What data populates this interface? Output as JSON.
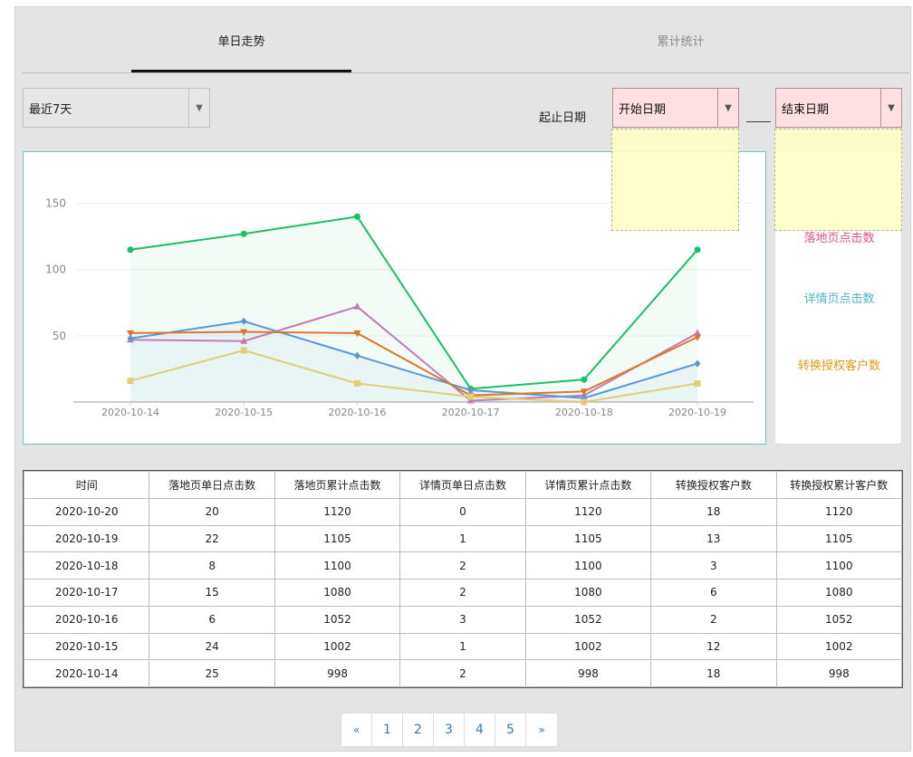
{
  "tabs": [
    {
      "label": "单日走势",
      "active": true
    },
    {
      "label": "累计统计",
      "active": false
    }
  ],
  "filters": {
    "range_select": {
      "value": "最近7天"
    },
    "date_label": "起止日期",
    "start_date": {
      "value": "开始日期"
    },
    "end_date": {
      "value": "结束日期"
    }
  },
  "legend": {
    "items": [
      {
        "label": "落地页点击数",
        "color": "#e8527a"
      },
      {
        "label": "详情页点击数",
        "color": "#4db8c4"
      },
      {
        "label": "转换授权客户数",
        "color": "#e89a1a"
      }
    ]
  },
  "chart_data": {
    "type": "line",
    "x": [
      "2020-10-14",
      "2020-10-15",
      "2020-10-16",
      "2020-10-17",
      "2020-10-18",
      "2020-10-19"
    ],
    "yticks": [
      50,
      100,
      150
    ],
    "ylim": [
      0,
      175
    ],
    "grid": true,
    "series": [
      {
        "color": "#1bbf64",
        "marker": "circle",
        "area": true,
        "values": [
          115,
          127,
          140,
          10,
          17,
          115
        ]
      },
      {
        "color": "#c07cb8",
        "marker": "triangle",
        "area": false,
        "values": [
          47,
          46,
          72,
          1,
          5,
          52
        ]
      },
      {
        "color": "#5a97d6",
        "marker": "diamond",
        "area": true,
        "values": [
          48,
          61,
          35,
          9,
          3,
          29
        ]
      },
      {
        "color": "#d9782e",
        "marker": "triangle-down",
        "area": false,
        "values": [
          52,
          53,
          52,
          5,
          8,
          49
        ]
      },
      {
        "color": "#e3cc78",
        "marker": "square",
        "area": false,
        "values": [
          16,
          39,
          14,
          4,
          0,
          14
        ]
      }
    ]
  },
  "table": {
    "headers": [
      "时间",
      "落地页单日点击数",
      "落地页累计点击数",
      "详情页单日点击数",
      "详情页累计点击数",
      "转换授权客户数",
      "转换授权累计客户数"
    ],
    "rows": [
      [
        "2020-10-20",
        "20",
        "1120",
        "0",
        "1120",
        "18",
        "1120"
      ],
      [
        "2020-10-19",
        "22",
        "1105",
        "1",
        "1105",
        "13",
        "1105"
      ],
      [
        "2020-10-18",
        "8",
        "1100",
        "2",
        "1100",
        "3",
        "1100"
      ],
      [
        "2020-10-17",
        "15",
        "1080",
        "2",
        "1080",
        "6",
        "1080"
      ],
      [
        "2020-10-16",
        "6",
        "1052",
        "3",
        "1052",
        "2",
        "1052"
      ],
      [
        "2020-10-15",
        "24",
        "1002",
        "1",
        "1002",
        "12",
        "1002"
      ],
      [
        "2020-10-14",
        "25",
        "998",
        "2",
        "998",
        "18",
        "998"
      ]
    ]
  },
  "pagination": {
    "prev": "«",
    "pages": [
      "1",
      "2",
      "3",
      "4",
      "5"
    ],
    "next": "»"
  },
  "icons": {
    "dropdown": "chevron-down-icon"
  }
}
